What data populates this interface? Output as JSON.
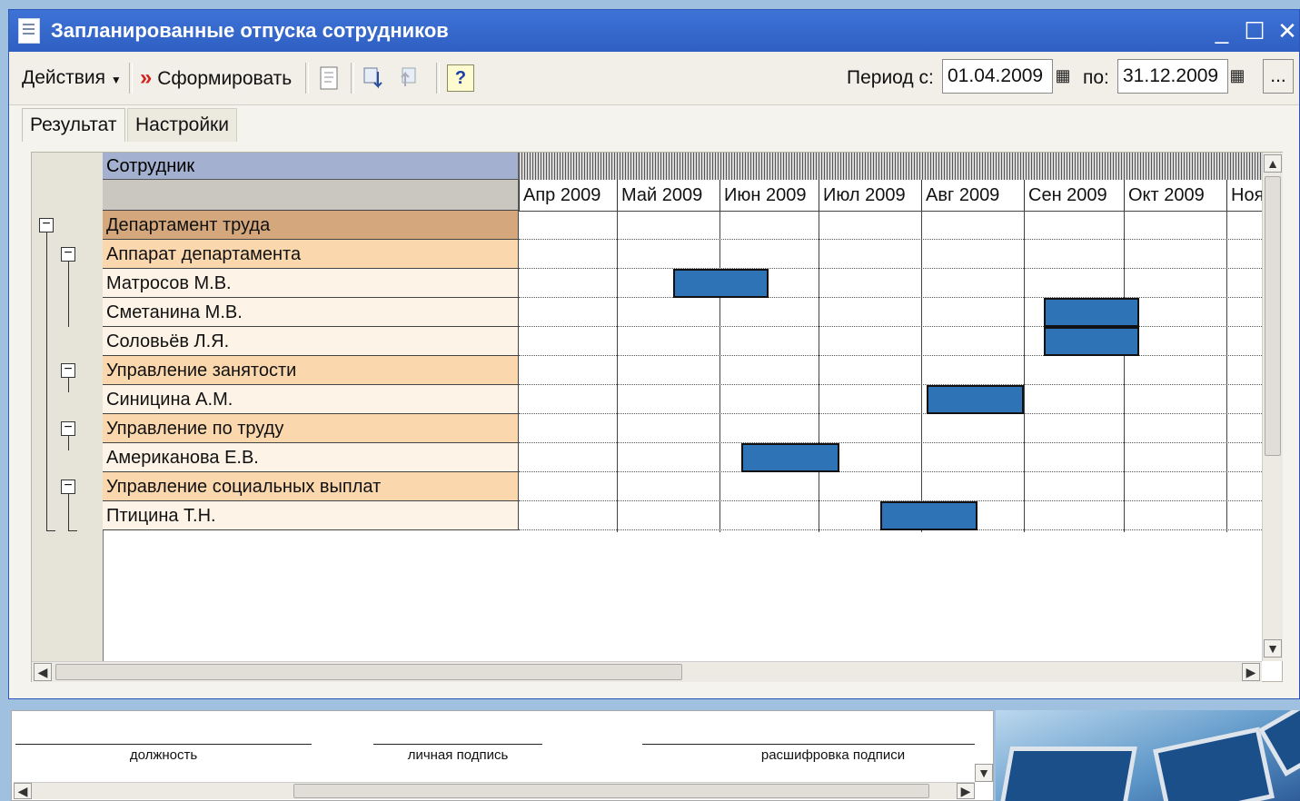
{
  "window": {
    "title": "Запланированные отпуска сотрудников",
    "controls": [
      "_",
      "☐",
      "✕"
    ]
  },
  "toolbar": {
    "actions_label": "Действия",
    "generate_label": "Сформировать",
    "help_label": "?",
    "period_from_label": "Период с:",
    "period_from_value": "01.04.2009",
    "period_to_label": "по:",
    "period_to_value": "31.12.2009",
    "more_label": "..."
  },
  "tabs": [
    {
      "label": "Результат",
      "active": true
    },
    {
      "label": "Настройки",
      "active": false
    }
  ],
  "report": {
    "column_header": "Сотрудник",
    "months": [
      "Апр 2009",
      "Май 2009",
      "Июн 2009",
      "Июл 2009",
      "Авг 2009",
      "Сен 2009",
      "Окт 2009",
      "Ноя"
    ],
    "rows": [
      {
        "label": "Департамент труда",
        "level": "dept"
      },
      {
        "label": "Аппарат департамента",
        "level": "sub"
      },
      {
        "label": "Матросов М.В.",
        "level": "emp"
      },
      {
        "label": "Сметанина М.В.",
        "level": "emp"
      },
      {
        "label": "Соловьёв Л.Я.",
        "level": "emp"
      },
      {
        "label": "Управление занятости",
        "level": "sub"
      },
      {
        "label": "Синицина А.М.",
        "level": "emp"
      },
      {
        "label": "Управление по труду",
        "level": "sub"
      },
      {
        "label": "Американова Е.В.",
        "level": "emp"
      },
      {
        "label": "Управление социальных выплат",
        "level": "sub"
      },
      {
        "label": "Птицина Т.Н.",
        "level": "emp"
      }
    ],
    "vacations": [
      {
        "employee": "Матросов М.В.",
        "row": 2,
        "start_month": 1.55,
        "end_month": 2.5
      },
      {
        "employee": "Сметанина М.В.",
        "row": 3,
        "start_month": 5.2,
        "end_month": 6.15
      },
      {
        "employee": "Соловьёв Л.Я.",
        "row": 4,
        "start_month": 5.2,
        "end_month": 6.15
      },
      {
        "employee": "Синицина А.М.",
        "row": 6,
        "start_month": 4.05,
        "end_month": 5.0
      },
      {
        "employee": "Американова Е.В.",
        "row": 8,
        "start_month": 2.22,
        "end_month": 3.2
      },
      {
        "employee": "Птицина Т.Н.",
        "row": 10,
        "start_month": 3.6,
        "end_month": 4.55
      }
    ],
    "bar_color": "#2f73b7"
  },
  "footer": {
    "labels": [
      "должность",
      "личная подпись",
      "расшифровка подписи"
    ]
  }
}
